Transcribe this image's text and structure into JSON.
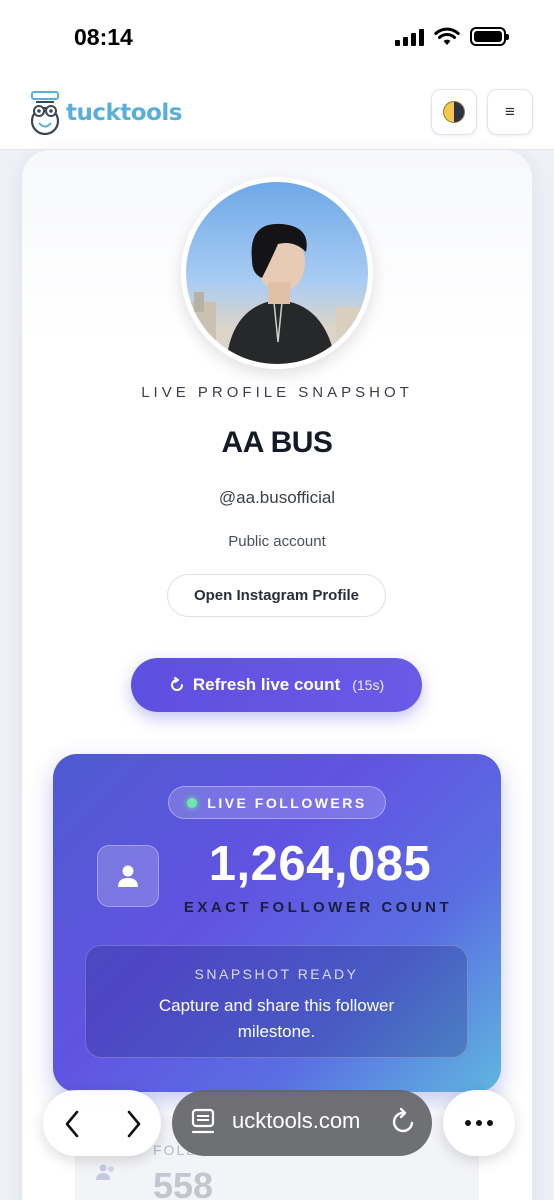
{
  "status_bar": {
    "time": "08:14"
  },
  "header": {
    "brand": "tucktools",
    "theme_icon": "half-moon-icon",
    "menu_icon": "≡"
  },
  "profile": {
    "snapshot_label": "LIVE PROFILE SNAPSHOT",
    "name": "AA BUS",
    "handle": "@aa.busofficial",
    "account_type": "Public account",
    "open_button": "Open Instagram Profile",
    "refresh_button": "Refresh live count",
    "refresh_timer": "(15s)"
  },
  "live_followers": {
    "badge": "LIVE FOLLOWERS",
    "count": "1,264,085",
    "caption": "EXACT FOLLOWER COUNT",
    "snapshot_title": "SNAPSHOT READY",
    "snapshot_text": "Capture and share this follower milestone."
  },
  "next_card": {
    "label": "FOLL",
    "value": "558"
  },
  "browser": {
    "url": "ucktools.com"
  },
  "colors": {
    "accent": "#5e4fe0",
    "brand": "#5aaed8",
    "live_dot": "#6ee7a8"
  }
}
